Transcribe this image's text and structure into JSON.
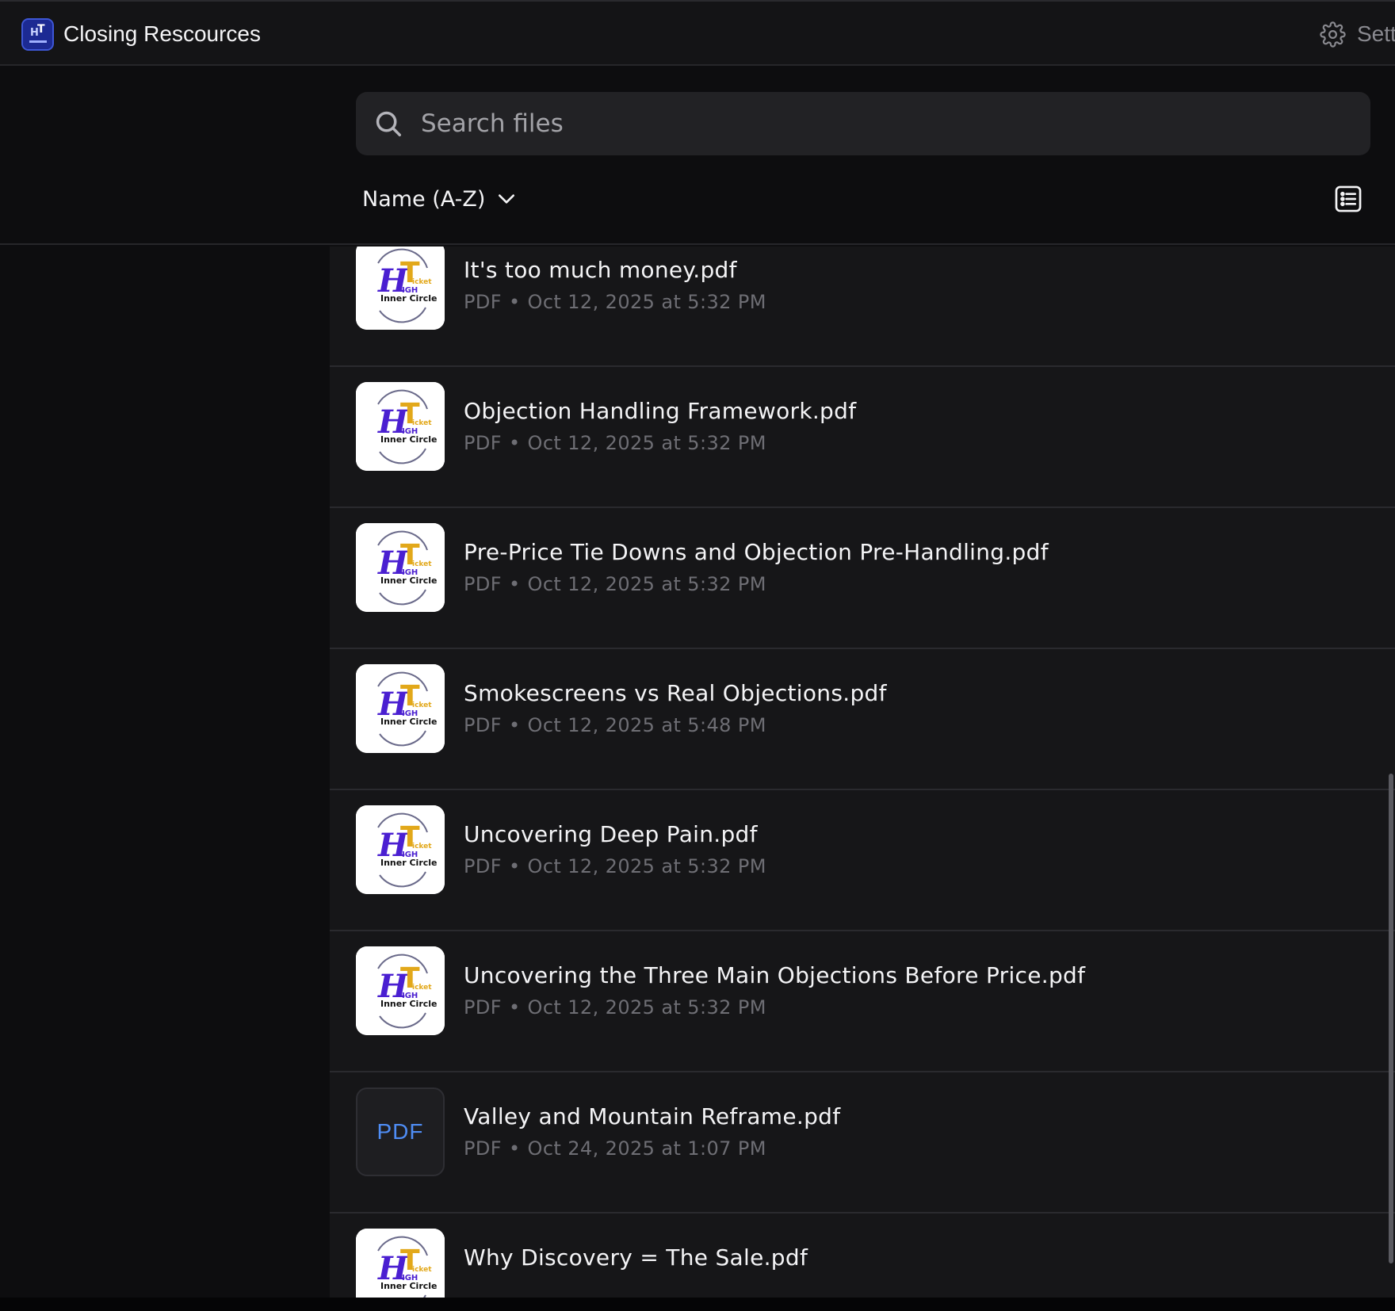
{
  "app": {
    "title": "Closing Rescources",
    "icon": "app-logo-icon",
    "settings_label": "Sett",
    "settings_icon": "gear-icon"
  },
  "search": {
    "placeholder": "Search files",
    "value": "",
    "icon": "search-icon"
  },
  "sort": {
    "label": "Name (A-Z)",
    "icon": "chevron-down-icon"
  },
  "view_toggle": {
    "icon": "list-view-icon"
  },
  "thumbnail_logo": {
    "lines": [
      "H",
      "T",
      "icket",
      "IGH",
      "Inner Circle"
    ],
    "colors": {
      "primary": "#4a1fd1",
      "accent": "#e2a81a",
      "text": "#111111"
    }
  },
  "files": [
    {
      "name": "It's too much money.pdf",
      "type": "PDF",
      "date": "Oct 12, 2025 at 5:32 PM",
      "thumb": "logo"
    },
    {
      "name": "Objection Handling Framework.pdf",
      "type": "PDF",
      "date": "Oct 12, 2025 at 5:32 PM",
      "thumb": "logo"
    },
    {
      "name": "Pre-Price Tie Downs and Objection Pre-Handling.pdf",
      "type": "PDF",
      "date": "Oct 12, 2025 at 5:32 PM",
      "thumb": "logo"
    },
    {
      "name": "Smokescreens vs Real Objections.pdf",
      "type": "PDF",
      "date": "Oct 12, 2025 at 5:48 PM",
      "thumb": "logo"
    },
    {
      "name": "Uncovering Deep Pain.pdf",
      "type": "PDF",
      "date": "Oct 12, 2025 at 5:32 PM",
      "thumb": "logo"
    },
    {
      "name": "Uncovering the Three Main Objections Before Price.pdf",
      "type": "PDF",
      "date": "Oct 12, 2025 at 5:32 PM",
      "thumb": "logo"
    },
    {
      "name": "Valley and Mountain Reframe.pdf",
      "type": "PDF",
      "date": "Oct 24, 2025 at 1:07 PM",
      "thumb": "pdf"
    },
    {
      "name": "Why Discovery = The Sale.pdf",
      "type": "",
      "date": "",
      "thumb": "logo"
    }
  ],
  "pdf_thumb_label": "PDF",
  "colors": {
    "background": "#0d0d0f",
    "row_background": "#161618",
    "accent_blue": "#4f8df5",
    "meta_text": "#6e6e74"
  }
}
